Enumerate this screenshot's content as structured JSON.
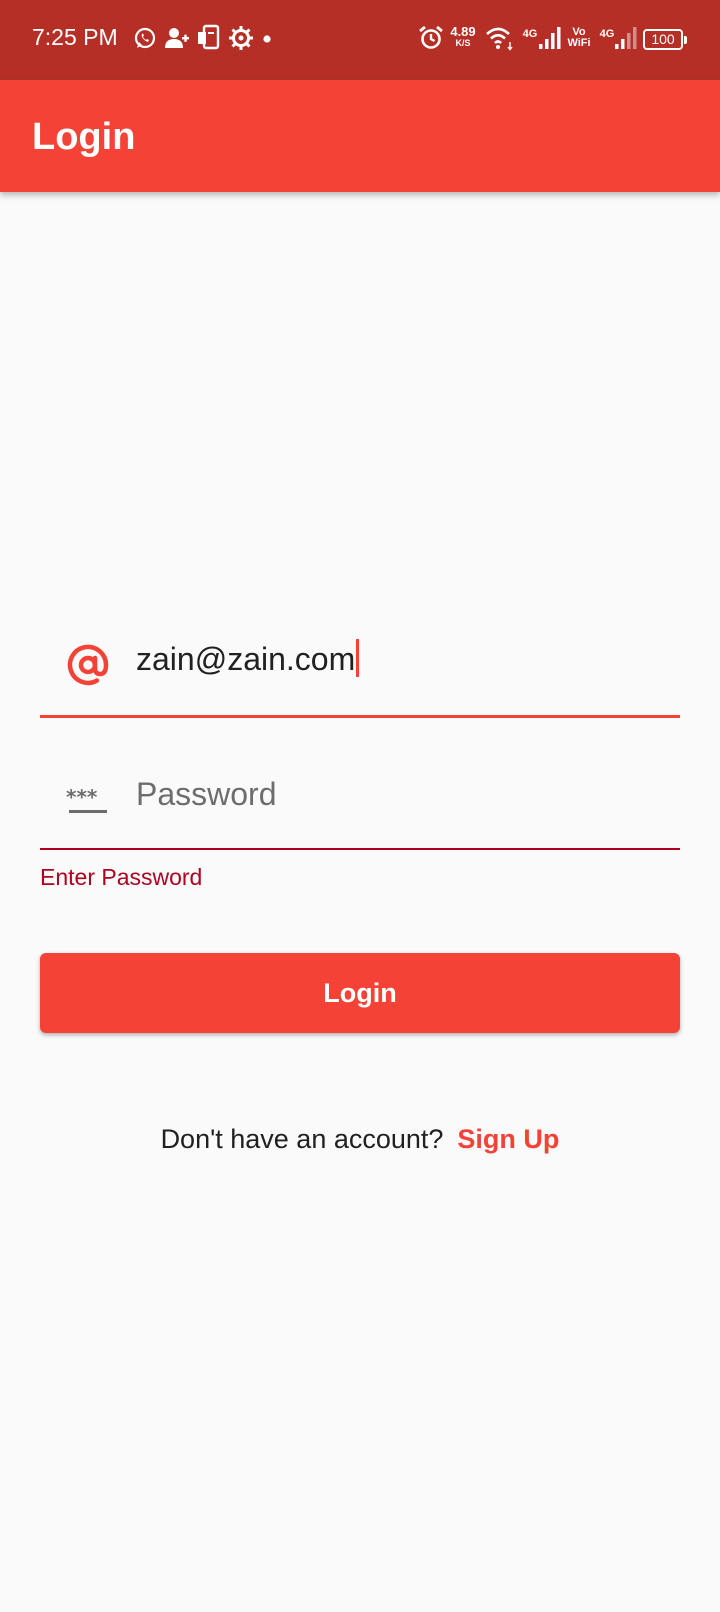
{
  "status_bar": {
    "time": "7:25 PM",
    "net_speed_value": "4.89",
    "net_speed_unit": "K/S",
    "sim1_tech": "4G",
    "vowifi_top": "Vo",
    "vowifi_bottom": "WiFi",
    "sim2_tech": "4G",
    "battery": "100",
    "icons": [
      "whatsapp-icon",
      "add-person-icon",
      "phone-clipboard-icon",
      "gear-icon",
      "dot-icon",
      "alarm-icon",
      "wifi-icon",
      "signal-icon",
      "battery-icon"
    ]
  },
  "app_bar": {
    "title": "Login"
  },
  "email_field": {
    "value": "zain@zain.com",
    "icon": "at-sign-icon"
  },
  "password_field": {
    "placeholder": "Password",
    "icon": "password-icon",
    "error": "Enter Password"
  },
  "login_button": {
    "label": "Login"
  },
  "signup": {
    "question": "Don't have an account?",
    "link": "Sign Up"
  },
  "colors": {
    "status_bar": "#b52f27",
    "primary": "#f44336",
    "error": "#b00020",
    "background": "#fafafa"
  }
}
